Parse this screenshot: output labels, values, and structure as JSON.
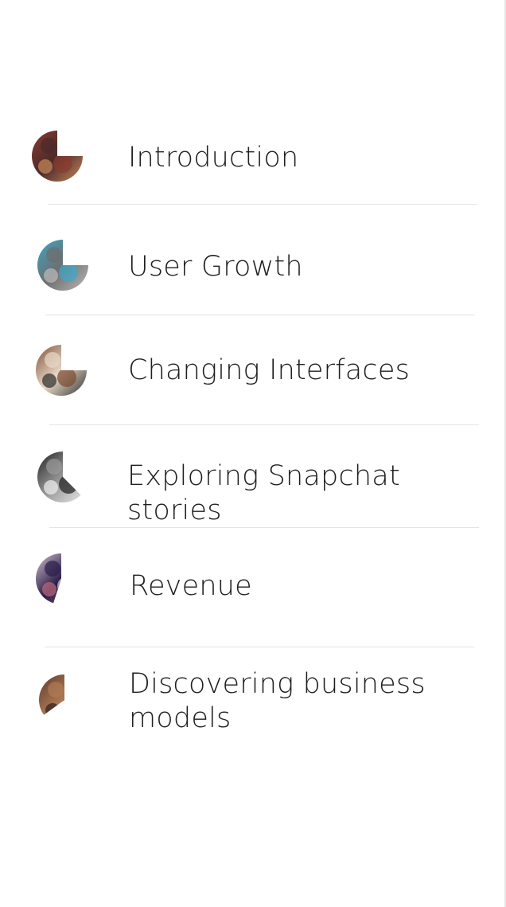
{
  "chapters": [
    {
      "title": "Introduction",
      "thumb_icon": "pie-progress-icon",
      "progress": 0.75,
      "colors": [
        "#8a3b2f",
        "#4b2a2a",
        "#c98a5a"
      ]
    },
    {
      "title": "User Growth",
      "thumb_icon": "pie-progress-icon",
      "progress": 0.75,
      "colors": [
        "#3aa8c9",
        "#6e6e6e",
        "#bcbcbc"
      ]
    },
    {
      "title": "Changing Interfaces",
      "thumb_icon": "pie-progress-icon",
      "progress": 0.75,
      "colors": [
        "#7a4a2e",
        "#e8d8c8",
        "#2b2b2b"
      ]
    },
    {
      "title": "Exploring Snapchat stories",
      "thumb_icon": "pie-progress-icon",
      "progress": 0.625,
      "colors": [
        "#1e1e1e",
        "#9a9a9a",
        "#f0f0f0"
      ]
    },
    {
      "title": "Revenue",
      "thumb_icon": "pie-progress-icon",
      "progress": 0.45,
      "colors": [
        "#d7c6d0",
        "#2a1d4a",
        "#c06a7a"
      ]
    },
    {
      "title": "Discovering business models",
      "thumb_icon": "pie-progress-icon",
      "progress": 0.35,
      "colors": [
        "#5a3a2a",
        "#b07a55",
        "#2a2020"
      ]
    }
  ]
}
